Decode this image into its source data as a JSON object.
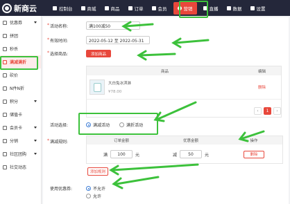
{
  "brand": {
    "name": "新商云"
  },
  "nav": [
    {
      "label": "控制台",
      "icon": "home-icon"
    },
    {
      "label": "商城",
      "icon": "store-icon"
    },
    {
      "label": "商品",
      "icon": "goods-icon"
    },
    {
      "label": "订单",
      "icon": "order-icon"
    },
    {
      "label": "会员",
      "icon": "member-icon"
    },
    {
      "label": "营销",
      "icon": "marketing-icon",
      "active": true
    },
    {
      "label": "直播",
      "icon": "live-icon"
    },
    {
      "label": "数据",
      "icon": "data-icon"
    },
    {
      "label": "设置",
      "icon": "settings-icon"
    }
  ],
  "sidebar": [
    {
      "label": "优惠券",
      "icon": "coupon-icon",
      "caret": true
    },
    {
      "label": "拼团",
      "icon": "group-icon"
    },
    {
      "label": "秒杀",
      "icon": "seckill-icon"
    },
    {
      "label": "满减满折",
      "icon": "discount-icon",
      "active": true
    },
    {
      "label": "砍价",
      "icon": "bargain-icon"
    },
    {
      "label": "N件N折",
      "icon": "nitem-icon"
    },
    {
      "label": "积分",
      "icon": "points-icon",
      "caret": true
    },
    {
      "label": "储值卡",
      "icon": "card-icon"
    },
    {
      "label": "会员卡",
      "icon": "vip-icon",
      "caret": true
    },
    {
      "label": "分销",
      "icon": "distribution-icon",
      "caret": true
    },
    {
      "label": "社区团购",
      "icon": "community-icon",
      "caret": true
    },
    {
      "label": "社交动态",
      "icon": "social-icon"
    }
  ],
  "form": {
    "name_label": "活动名称:",
    "name_value": "满100减50",
    "time_label": "有效时间:",
    "time_value": "2022-05-12 至 2022-05-31",
    "goods_label": "选择商品:",
    "add_goods_button": "添加商品",
    "goods_table": {
      "col_goods": "商品",
      "col_op": "编辑",
      "rows": [
        {
          "name": "大白兔冰淇淋",
          "price": "¥78.00",
          "action": "删除"
        }
      ]
    },
    "pager": {
      "prev": "‹",
      "current": "1",
      "next": "›"
    },
    "activity_label": "活动选择:",
    "activity_options": [
      "满减活动",
      "满折活动"
    ],
    "rule_label": "满减规则:",
    "rule_table": {
      "col_amount": "订单金额",
      "col_discount": "优惠金额",
      "col_op": "操作",
      "full_prefix": "满",
      "full_value": "100",
      "full_unit": "元",
      "minus_prefix": "减",
      "minus_value": "50",
      "minus_unit": "元",
      "delete_button": "删除"
    },
    "add_rule_button": "添加规则",
    "coupon_label": "使用优惠券:",
    "coupon_options": [
      "不允许",
      "允许"
    ]
  },
  "colors": {
    "accent": "#e8473b",
    "highlight": "#3cc13b",
    "radio": "#3a7bd5"
  }
}
